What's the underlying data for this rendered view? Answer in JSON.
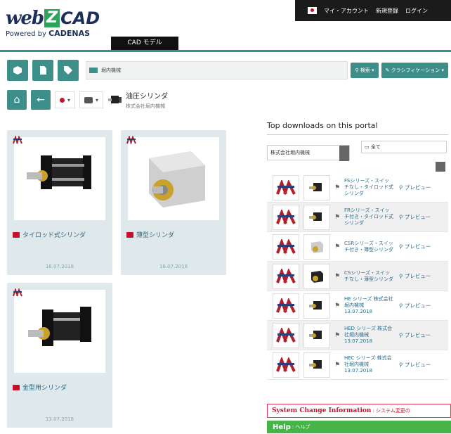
{
  "header": {
    "logo_web": "web",
    "logo_z": "Z",
    "logo_cad": "CAD",
    "logo_powered": "Powered by ",
    "logo_brand": "CADENAS",
    "tab": "CAD モデル",
    "topbar": {
      "account": "マイ・アカウント",
      "register": "新規登録",
      "login": "ログイン"
    }
  },
  "toolbar": {
    "search_value": "堀内機械",
    "search_button": "検索",
    "classification": "クラシフィケーション"
  },
  "breadcrumb": {
    "title": "油圧シリンダ",
    "subtitle": "株式会社堀内機械"
  },
  "cards": [
    {
      "label": "タイロッド式シリンダ",
      "date": "16.07.2018"
    },
    {
      "label": "薄型シリンダ",
      "date": "16.07.2018"
    },
    {
      "label": "金型用シリンダ",
      "date": "13.07.2018"
    }
  ],
  "panel": {
    "title": "Top downloads on this portal",
    "filter_supplier": "株式会社堀内機械",
    "filter_all": "全て",
    "items": [
      {
        "name": "FSシリーズ・スイッチなし・タイロッド式シリンダ",
        "preview": "プレビュー"
      },
      {
        "name": "FRシリーズ・スイッチ付き・タイロッド式シリンダ",
        "preview": "プレビュー"
      },
      {
        "name": "CSRシリーズ・スイッチ付き・薄型シリンダ",
        "preview": "プレビュー"
      },
      {
        "name": "CSシリーズ・スイッチなし・薄型シリンダ",
        "preview": "プレビュー"
      },
      {
        "name": "HE シリーズ 株式会社堀内機械 13.07.2018",
        "preview": "プレビュー"
      },
      {
        "name": "HED シリーズ 株式会社堀内機械 13.07.2018",
        "preview": "プレビュー"
      },
      {
        "name": "HEC シリーズ 株式会社堀内機械 13.07.2018",
        "preview": "プレビュー"
      }
    ]
  },
  "footer": {
    "system_change": "System Change Information",
    "system_change_sub": ": システム変更の",
    "help": "Help",
    "help_sub": ": ヘルプ"
  }
}
